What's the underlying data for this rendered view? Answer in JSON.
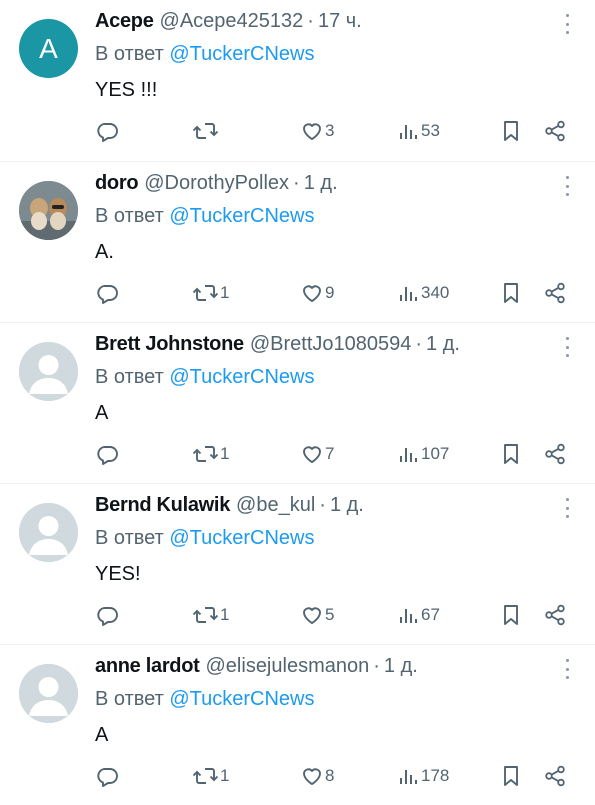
{
  "reply_prefix": "В ответ",
  "tweets": [
    {
      "name": "Acepe",
      "handle": "@Acepe425132",
      "time": "17 ч.",
      "reply_to": "@TuckerCNews",
      "text": "YES !!!",
      "avatar": {
        "type": "letter",
        "letter": "A",
        "color": "#1a96a4"
      },
      "retweets": "",
      "likes": "3",
      "views": "53"
    },
    {
      "name": "doro",
      "handle": "@DorothyPollex",
      "time": "1 д.",
      "reply_to": "@TuckerCNews",
      "text": "A.",
      "avatar": {
        "type": "photo",
        "icon": "dogs-photo-avatar"
      },
      "retweets": "1",
      "likes": "9",
      "views": "340"
    },
    {
      "name": "Brett Johnstone",
      "handle": "@BrettJo1080594",
      "time": "1 д.",
      "reply_to": "@TuckerCNews",
      "text": "A",
      "avatar": {
        "type": "default",
        "icon": "default-profile-avatar"
      },
      "retweets": "1",
      "likes": "7",
      "views": "107"
    },
    {
      "name": "Bernd Kulawik",
      "handle": "@be_kul",
      "time": "1 д.",
      "reply_to": "@TuckerCNews",
      "text": "YES!",
      "avatar": {
        "type": "default",
        "icon": "default-profile-avatar"
      },
      "retweets": "1",
      "likes": "5",
      "views": "67"
    },
    {
      "name": "anne lardot",
      "handle": "@elisejulesmanon",
      "time": "1 д.",
      "reply_to": "@TuckerCNews",
      "text": "A",
      "avatar": {
        "type": "default",
        "icon": "default-profile-avatar"
      },
      "retweets": "1",
      "likes": "8",
      "views": "178"
    }
  ],
  "icons": {
    "reply": "reply-bubble-icon",
    "retweet": "retweet-icon",
    "like": "heart-icon",
    "views": "views-bar-chart-icon",
    "bookmark": "bookmark-icon",
    "share": "share-icon",
    "more": "more-vertical-icon"
  },
  "colors": {
    "text": "#0f1419",
    "muted": "#536471",
    "link": "#1d9bf0",
    "divider": "#eff3f4",
    "default_avatar": "#cfd9de"
  }
}
